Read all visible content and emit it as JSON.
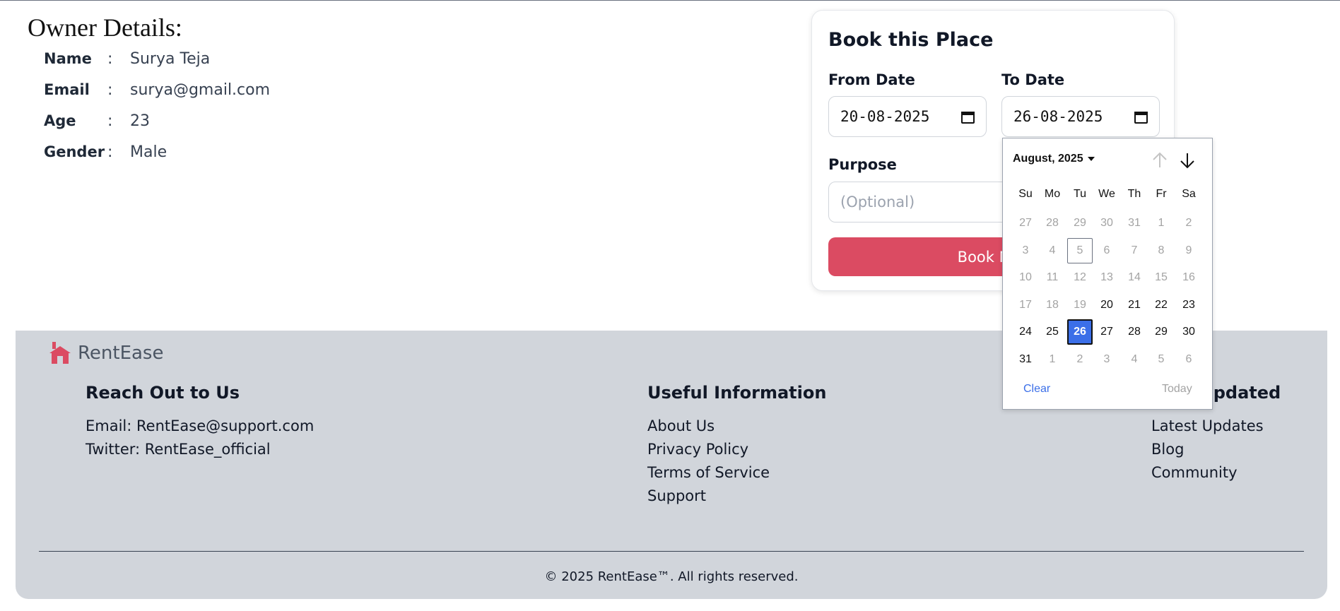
{
  "owner": {
    "title": "Owner Details:",
    "rows": [
      {
        "key": "Name",
        "colon": ":",
        "value": "Surya Teja"
      },
      {
        "key": "Email",
        "colon": ":",
        "value": "surya@gmail.com"
      },
      {
        "key": "Age",
        "colon": ":",
        "value": "23"
      },
      {
        "key": "Gender",
        "colon": ":",
        "value": "Male"
      }
    ]
  },
  "booking": {
    "title": "Book this Place",
    "from_label": "From Date",
    "from_value": "20-08-2025",
    "to_label": "To Date",
    "to_value": "26-08-2025",
    "purpose_label": "Purpose",
    "purpose_placeholder": "(Optional)",
    "book_button": "Book Now"
  },
  "datepicker": {
    "month_label": "August, 2025",
    "weekdays": [
      "Su",
      "Mo",
      "Tu",
      "We",
      "Th",
      "Fr",
      "Sa"
    ],
    "weeks": [
      [
        {
          "d": "27",
          "s": "muted"
        },
        {
          "d": "28",
          "s": "muted"
        },
        {
          "d": "29",
          "s": "muted"
        },
        {
          "d": "30",
          "s": "muted"
        },
        {
          "d": "31",
          "s": "muted"
        },
        {
          "d": "1",
          "s": "muted"
        },
        {
          "d": "2",
          "s": "muted"
        }
      ],
      [
        {
          "d": "3",
          "s": "muted"
        },
        {
          "d": "4",
          "s": "muted"
        },
        {
          "d": "5",
          "s": "today"
        },
        {
          "d": "6",
          "s": "muted"
        },
        {
          "d": "7",
          "s": "muted"
        },
        {
          "d": "8",
          "s": "muted"
        },
        {
          "d": "9",
          "s": "muted"
        }
      ],
      [
        {
          "d": "10",
          "s": "muted"
        },
        {
          "d": "11",
          "s": "muted"
        },
        {
          "d": "12",
          "s": "muted"
        },
        {
          "d": "13",
          "s": "muted"
        },
        {
          "d": "14",
          "s": "muted"
        },
        {
          "d": "15",
          "s": "muted"
        },
        {
          "d": "16",
          "s": "muted"
        }
      ],
      [
        {
          "d": "17",
          "s": "muted"
        },
        {
          "d": "18",
          "s": "muted"
        },
        {
          "d": "19",
          "s": "muted"
        },
        {
          "d": "20",
          "s": "active"
        },
        {
          "d": "21",
          "s": "active"
        },
        {
          "d": "22",
          "s": "active"
        },
        {
          "d": "23",
          "s": "active"
        }
      ],
      [
        {
          "d": "24",
          "s": "active"
        },
        {
          "d": "25",
          "s": "active"
        },
        {
          "d": "26",
          "s": "selected"
        },
        {
          "d": "27",
          "s": "active"
        },
        {
          "d": "28",
          "s": "active"
        },
        {
          "d": "29",
          "s": "active"
        },
        {
          "d": "30",
          "s": "active"
        }
      ],
      [
        {
          "d": "31",
          "s": "active"
        },
        {
          "d": "1",
          "s": "muted-next"
        },
        {
          "d": "2",
          "s": "muted-next"
        },
        {
          "d": "3",
          "s": "muted-next"
        },
        {
          "d": "4",
          "s": "muted-next"
        },
        {
          "d": "5",
          "s": "muted-next"
        },
        {
          "d": "6",
          "s": "muted-next"
        }
      ]
    ],
    "clear_label": "Clear",
    "today_label": "Today",
    "accent_color": "#3b6fe8"
  },
  "footer": {
    "brand": "RentEase",
    "brand_color": "#db4b62",
    "columns": [
      {
        "heading": "Reach Out to Us",
        "items": [
          "Email: RentEase@support.com",
          "Twitter: RentEase_official"
        ]
      },
      {
        "heading": "Useful Information",
        "items": [
          "About Us",
          "Privacy Policy",
          "Terms of Service",
          "Support"
        ]
      },
      {
        "heading": "Stay Updated",
        "items": [
          "Latest Updates",
          "Blog",
          "Community"
        ]
      }
    ],
    "copyright": "© 2025 RentEase™. All rights reserved."
  }
}
